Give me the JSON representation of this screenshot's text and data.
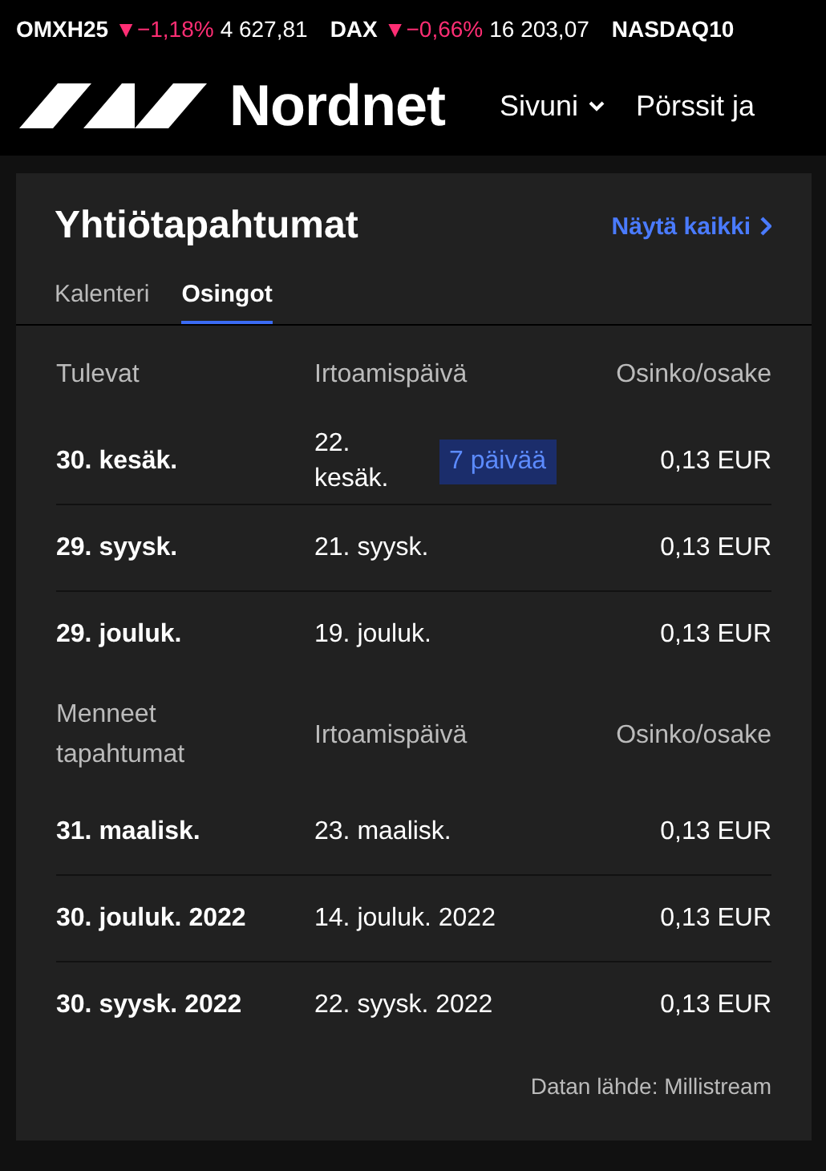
{
  "ticker": [
    {
      "name": "OMXH25",
      "arrow": "▼",
      "change": "−1,18%",
      "value": "4 627,81"
    },
    {
      "name": "DAX",
      "arrow": "▼",
      "change": "−0,66%",
      "value": "16 203,07"
    },
    {
      "name": "NASDAQ10"
    }
  ],
  "nav": {
    "brand": "Nordnet",
    "items": [
      {
        "label": "Sivuni",
        "dropdown": true
      },
      {
        "label": "Pörssit ja",
        "dropdown": false
      }
    ]
  },
  "card": {
    "title": "Yhtiötapahtumat",
    "link": "Näytä kaikki",
    "tabs": [
      {
        "label": "Kalenteri",
        "selected": false
      },
      {
        "label": "Osingot",
        "selected": true
      }
    ],
    "sections": [
      {
        "columns": [
          "Tulevat",
          "Irtoamispäivä",
          "Osinko/osake"
        ],
        "rows": [
          {
            "date": "30. kesäk.",
            "ex_date": "22. kesäk.",
            "badge": "7 päivää",
            "amount": "0,13 EUR"
          },
          {
            "date": "29. syysk.",
            "ex_date": "21. syysk.",
            "amount": "0,13 EUR"
          },
          {
            "date": "29. jouluk.",
            "ex_date": "19. jouluk.",
            "amount": "0,13 EUR"
          }
        ]
      },
      {
        "columns": [
          "Menneet tapahtumat",
          "Irtoamispäivä",
          "Osinko/osake"
        ],
        "rows": [
          {
            "date": "31. maalisk.",
            "ex_date": "23. maalisk.",
            "amount": "0,13 EUR"
          },
          {
            "date": "30. jouluk. 2022",
            "ex_date": "14. jouluk. 2022",
            "amount": "0,13 EUR"
          },
          {
            "date": "30. syysk. 2022",
            "ex_date": "22. syysk. 2022",
            "amount": "0,13 EUR"
          }
        ]
      }
    ],
    "source": "Datan lähde: Millistream"
  }
}
